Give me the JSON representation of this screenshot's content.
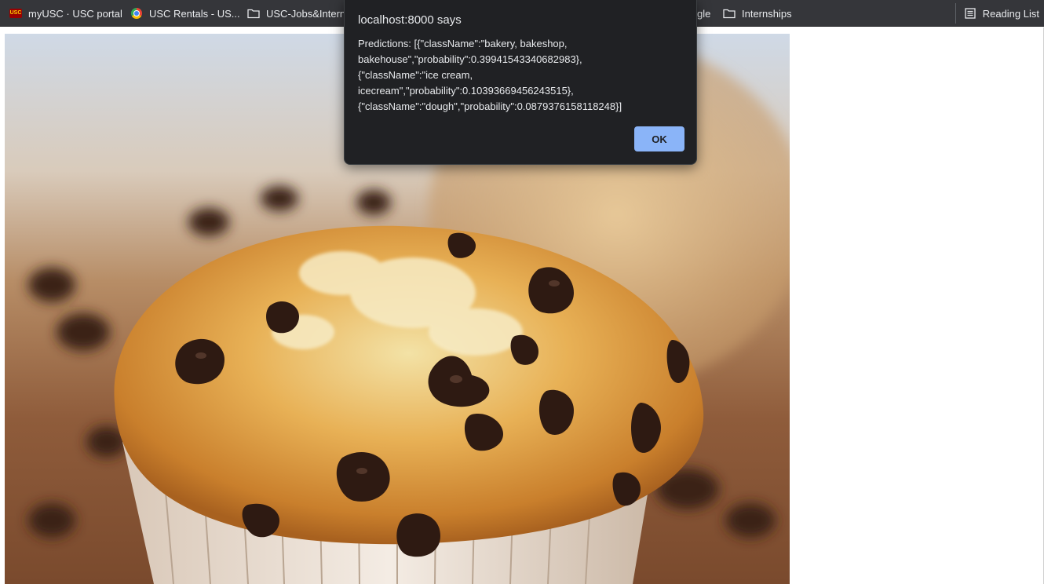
{
  "bookmarks": {
    "items": [
      {
        "label": "myUSC · USC portal",
        "icon": "usc-logo-icon"
      },
      {
        "label": "USC Rentals - US...",
        "icon": "chrome-icon"
      },
      {
        "label": "USC-Jobs&Intern",
        "icon": "folder-icon"
      },
      {
        "label": "gle",
        "icon": "partial"
      },
      {
        "label": "Internships",
        "icon": "folder-icon"
      }
    ],
    "reading_list": "Reading List",
    "usc_logo_text": "USC"
  },
  "dialog": {
    "title": "localhost:8000 says",
    "message_lines": [
      "Predictions: [{\"className\":\"bakery, bakeshop,",
      "bakehouse\",\"probability\":0.39941543340682983},",
      "{\"className\":\"ice cream,",
      "icecream\",\"probability\":0.10393669456243515},",
      "{\"className\":\"dough\",\"probability\":0.0879376158118248}]"
    ],
    "ok_label": "OK"
  },
  "photo": {
    "subject": "chocolate chip muffin"
  },
  "colors": {
    "toolbar_bg": "#35363a",
    "dialog_bg": "#202124",
    "button_accent": "#8ab4f8"
  }
}
